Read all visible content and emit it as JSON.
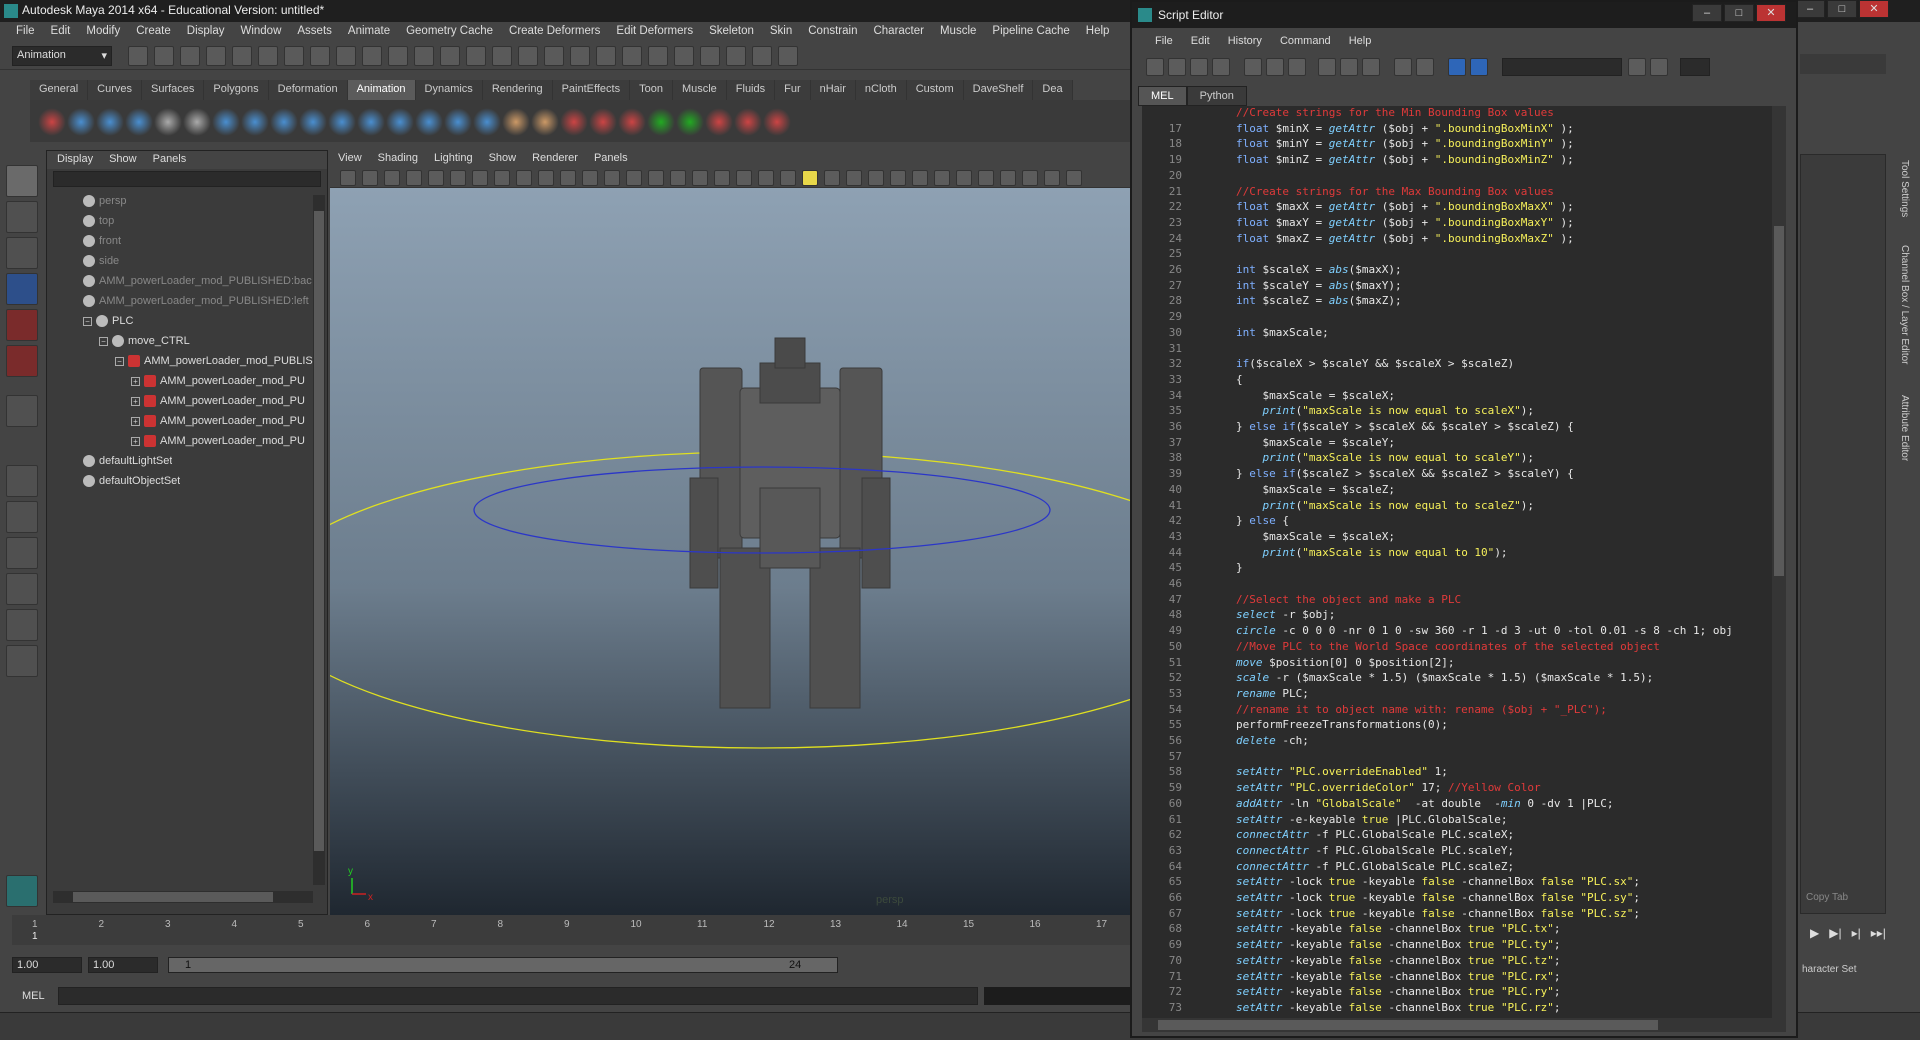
{
  "maya": {
    "title": "Autodesk Maya 2014 x64 - Educational Version: untitled*",
    "menu": [
      "File",
      "Edit",
      "Modify",
      "Create",
      "Display",
      "Window",
      "Assets",
      "Animate",
      "Geometry Cache",
      "Create Deformers",
      "Edit Deformers",
      "Skeleton",
      "Skin",
      "Constrain",
      "Character",
      "Muscle",
      "Pipeline Cache",
      "Help"
    ],
    "mode": "Animation",
    "shelf_tabs": [
      "General",
      "Curves",
      "Surfaces",
      "Polygons",
      "Deformation",
      "Animation",
      "Dynamics",
      "Rendering",
      "PaintEffects",
      "Toon",
      "Muscle",
      "Fluids",
      "Fur",
      "nHair",
      "nCloth",
      "Custom",
      "DaveShelf",
      "Dea"
    ],
    "active_shelf": "Animation"
  },
  "outliner": {
    "menu": [
      "Display",
      "Show",
      "Panels"
    ],
    "items": [
      {
        "label": "persp",
        "dim": true,
        "indent": 0
      },
      {
        "label": "top",
        "dim": true,
        "indent": 0
      },
      {
        "label": "front",
        "dim": true,
        "indent": 0
      },
      {
        "label": "side",
        "dim": true,
        "indent": 0
      },
      {
        "label": "AMM_powerLoader_mod_PUBLISHED:bac",
        "dim": true,
        "indent": 0
      },
      {
        "label": "AMM_powerLoader_mod_PUBLISHED:left",
        "dim": true,
        "indent": 0
      },
      {
        "label": "PLC",
        "dim": false,
        "indent": 0
      },
      {
        "label": "move_CTRL",
        "dim": false,
        "indent": 1
      },
      {
        "label": "AMM_powerLoader_mod_PUBLIS",
        "dim": false,
        "indent": 2
      },
      {
        "label": "AMM_powerLoader_mod_PU",
        "dim": false,
        "indent": 3
      },
      {
        "label": "AMM_powerLoader_mod_PU",
        "dim": false,
        "indent": 3
      },
      {
        "label": "AMM_powerLoader_mod_PU",
        "dim": false,
        "indent": 3
      },
      {
        "label": "AMM_powerLoader_mod_PU",
        "dim": false,
        "indent": 3
      },
      {
        "label": "defaultLightSet",
        "dim": false,
        "indent": 0
      },
      {
        "label": "defaultObjectSet",
        "dim": false,
        "indent": 0
      }
    ]
  },
  "viewport": {
    "menu": [
      "View",
      "Shading",
      "Lighting",
      "Show",
      "Renderer",
      "Panels"
    ],
    "camera": "persp",
    "axis_y": "y",
    "axis_x": "x"
  },
  "timeline": {
    "ticks": [
      "1",
      "2",
      "3",
      "4",
      "5",
      "6",
      "7",
      "8",
      "9",
      "10",
      "11",
      "12",
      "13",
      "14",
      "15",
      "16",
      "17"
    ],
    "current": "1",
    "start": "1.00",
    "start2": "1.00",
    "range_start": "1",
    "range_end": "24"
  },
  "cmdline": {
    "label": "MEL"
  },
  "right_tabs": [
    "Tool Settings",
    "Channel Box / Layer Editor",
    "Attribute Editor"
  ],
  "right_bottom": {
    "copy_tab": "Copy Tab",
    "character_set": "haracter Set"
  },
  "script_editor": {
    "title": "Script Editor",
    "menu": [
      "File",
      "Edit",
      "History",
      "Command",
      "Help"
    ],
    "tabs": [
      "MEL",
      "Python"
    ],
    "active_tab": "MEL",
    "lines": [
      {
        "n": "",
        "html": "<span class='cm'>//Create strings for the Min Bounding Box values</span>"
      },
      {
        "n": "17",
        "html": "<span class='kw'>float</span> $minX = <span class='fn'>getAttr</span> ($obj + <span class='st'>\".boundingBoxMinX\"</span> );"
      },
      {
        "n": "18",
        "html": "<span class='kw'>float</span> $minY = <span class='fn'>getAttr</span> ($obj + <span class='st'>\".boundingBoxMinY\"</span> );"
      },
      {
        "n": "19",
        "html": "<span class='kw'>float</span> $minZ = <span class='fn'>getAttr</span> ($obj + <span class='st'>\".boundingBoxMinZ\"</span> );"
      },
      {
        "n": "20",
        "html": ""
      },
      {
        "n": "21",
        "html": "<span class='cm'>//Create strings for the Max Bounding Box values</span>"
      },
      {
        "n": "22",
        "html": "<span class='kw'>float</span> $maxX = <span class='fn'>getAttr</span> ($obj + <span class='st'>\".boundingBoxMaxX\"</span> );"
      },
      {
        "n": "23",
        "html": "<span class='kw'>float</span> $maxY = <span class='fn'>getAttr</span> ($obj + <span class='st'>\".boundingBoxMaxY\"</span> );"
      },
      {
        "n": "24",
        "html": "<span class='kw'>float</span> $maxZ = <span class='fn'>getAttr</span> ($obj + <span class='st'>\".boundingBoxMaxZ\"</span> );"
      },
      {
        "n": "25",
        "html": ""
      },
      {
        "n": "26",
        "html": "<span class='kw'>int</span> $scaleX = <span class='fn'>abs</span>($maxX);"
      },
      {
        "n": "27",
        "html": "<span class='kw'>int</span> $scaleY = <span class='fn'>abs</span>($maxY);"
      },
      {
        "n": "28",
        "html": "<span class='kw'>int</span> $scaleZ = <span class='fn'>abs</span>($maxZ);"
      },
      {
        "n": "29",
        "html": ""
      },
      {
        "n": "30",
        "html": "<span class='kw'>int</span> $maxScale;"
      },
      {
        "n": "31",
        "html": ""
      },
      {
        "n": "32",
        "html": "<span class='kw'>if</span>($scaleX &gt; $scaleY &amp;&amp; $scaleX &gt; $scaleZ)"
      },
      {
        "n": "33",
        "html": "{"
      },
      {
        "n": "34",
        "html": "    $maxScale = $scaleX;"
      },
      {
        "n": "35",
        "html": "    <span class='fn'>print</span>(<span class='st'>\"maxScale is now equal to scaleX\"</span>);"
      },
      {
        "n": "36",
        "html": "} <span class='kw'>else if</span>($scaleY &gt; $scaleX &amp;&amp; $scaleY &gt; $scaleZ) {"
      },
      {
        "n": "37",
        "html": "    $maxScale = $scaleY;"
      },
      {
        "n": "38",
        "html": "    <span class='fn'>print</span>(<span class='st'>\"maxScale is now equal to scaleY\"</span>);"
      },
      {
        "n": "39",
        "html": "} <span class='kw'>else if</span>($scaleZ &gt; $scaleX &amp;&amp; $scaleZ &gt; $scaleY) {"
      },
      {
        "n": "40",
        "html": "    $maxScale = $scaleZ;"
      },
      {
        "n": "41",
        "html": "    <span class='fn'>print</span>(<span class='st'>\"maxScale is now equal to scaleZ\"</span>);"
      },
      {
        "n": "42",
        "html": "} <span class='kw'>else</span> {"
      },
      {
        "n": "43",
        "html": "    $maxScale = $scaleX;"
      },
      {
        "n": "44",
        "html": "    <span class='fn'>print</span>(<span class='st'>\"maxScale is now equal to 10\"</span>);"
      },
      {
        "n": "45",
        "html": "}"
      },
      {
        "n": "46",
        "html": ""
      },
      {
        "n": "47",
        "html": "<span class='cm'>//Select the object and make a PLC</span>"
      },
      {
        "n": "48",
        "html": "<span class='fn'>select</span> -r $obj;"
      },
      {
        "n": "49",
        "html": "<span class='fn'>circle</span> -c 0 0 0 -nr 0 1 0 -sw 360 -r 1 -d 3 -ut 0 -tol 0.01 -s 8 -ch 1; obj"
      },
      {
        "n": "50",
        "html": "<span class='cm'>//Move PLC to the World Space coordinates of the selected object</span>"
      },
      {
        "n": "51",
        "html": "<span class='fn'>move</span> $position[0] 0 $position[2];"
      },
      {
        "n": "52",
        "html": "<span class='fn'>scale</span> -r ($maxScale * 1.5) ($maxScale * 1.5) ($maxScale * 1.5);"
      },
      {
        "n": "53",
        "html": "<span class='fn'>rename</span> PLC;"
      },
      {
        "n": "54",
        "html": "<span class='cm'>//rename it to object name with: rename ($obj + \"_PLC\");</span>"
      },
      {
        "n": "55",
        "html": "performFreezeTransformations(0);"
      },
      {
        "n": "56",
        "html": "<span class='fn'>delete</span> -ch;"
      },
      {
        "n": "57",
        "html": ""
      },
      {
        "n": "58",
        "html": "<span class='fn'>setAttr</span> <span class='st'>\"PLC.overrideEnabled\"</span> 1;"
      },
      {
        "n": "59",
        "html": "<span class='fn'>setAttr</span> <span class='st'>\"PLC.overrideColor\"</span> 17; <span class='cm'>//Yellow Color</span>"
      },
      {
        "n": "60",
        "html": "<span class='fn'>addAttr</span> -ln <span class='st'>\"GlobalScale\"</span>  -at double  -<span class='fn'>min</span> 0 -dv 1 |PLC;"
      },
      {
        "n": "61",
        "html": "<span class='fn'>setAttr</span> -e-keyable <span class='bo'>true</span> |PLC.GlobalScale;"
      },
      {
        "n": "62",
        "html": "<span class='fn'>connectAttr</span> -f PLC.GlobalScale PLC.scaleX;"
      },
      {
        "n": "63",
        "html": "<span class='fn'>connectAttr</span> -f PLC.GlobalScale PLC.scaleY;"
      },
      {
        "n": "64",
        "html": "<span class='fn'>connectAttr</span> -f PLC.GlobalScale PLC.scaleZ;"
      },
      {
        "n": "65",
        "html": "<span class='fn'>setAttr</span> -lock <span class='bo'>true</span> -keyable <span class='bo'>false</span> -channelBox <span class='bo'>false</span> <span class='st'>\"PLC.sx\"</span>;"
      },
      {
        "n": "66",
        "html": "<span class='fn'>setAttr</span> -lock <span class='bo'>true</span> -keyable <span class='bo'>false</span> -channelBox <span class='bo'>false</span> <span class='st'>\"PLC.sy\"</span>;"
      },
      {
        "n": "67",
        "html": "<span class='fn'>setAttr</span> -lock <span class='bo'>true</span> -keyable <span class='bo'>false</span> -channelBox <span class='bo'>false</span> <span class='st'>\"PLC.sz\"</span>;"
      },
      {
        "n": "68",
        "html": "<span class='fn'>setAttr</span> -keyable <span class='bo'>false</span> -channelBox <span class='bo'>true</span> <span class='st'>\"PLC.tx\"</span>;"
      },
      {
        "n": "69",
        "html": "<span class='fn'>setAttr</span> -keyable <span class='bo'>false</span> -channelBox <span class='bo'>true</span> <span class='st'>\"PLC.ty\"</span>;"
      },
      {
        "n": "70",
        "html": "<span class='fn'>setAttr</span> -keyable <span class='bo'>false</span> -channelBox <span class='bo'>true</span> <span class='st'>\"PLC.tz\"</span>;"
      },
      {
        "n": "71",
        "html": "<span class='fn'>setAttr</span> -keyable <span class='bo'>false</span> -channelBox <span class='bo'>true</span> <span class='st'>\"PLC.rx\"</span>;"
      },
      {
        "n": "72",
        "html": "<span class='fn'>setAttr</span> -keyable <span class='bo'>false</span> -channelBox <span class='bo'>true</span> <span class='st'>\"PLC.ry\"</span>;"
      },
      {
        "n": "73",
        "html": "<span class='fn'>setAttr</span> -keyable <span class='bo'>false</span> -channelBox <span class='bo'>true</span> <span class='st'>\"PLC.rz\"</span>;"
      }
    ]
  }
}
